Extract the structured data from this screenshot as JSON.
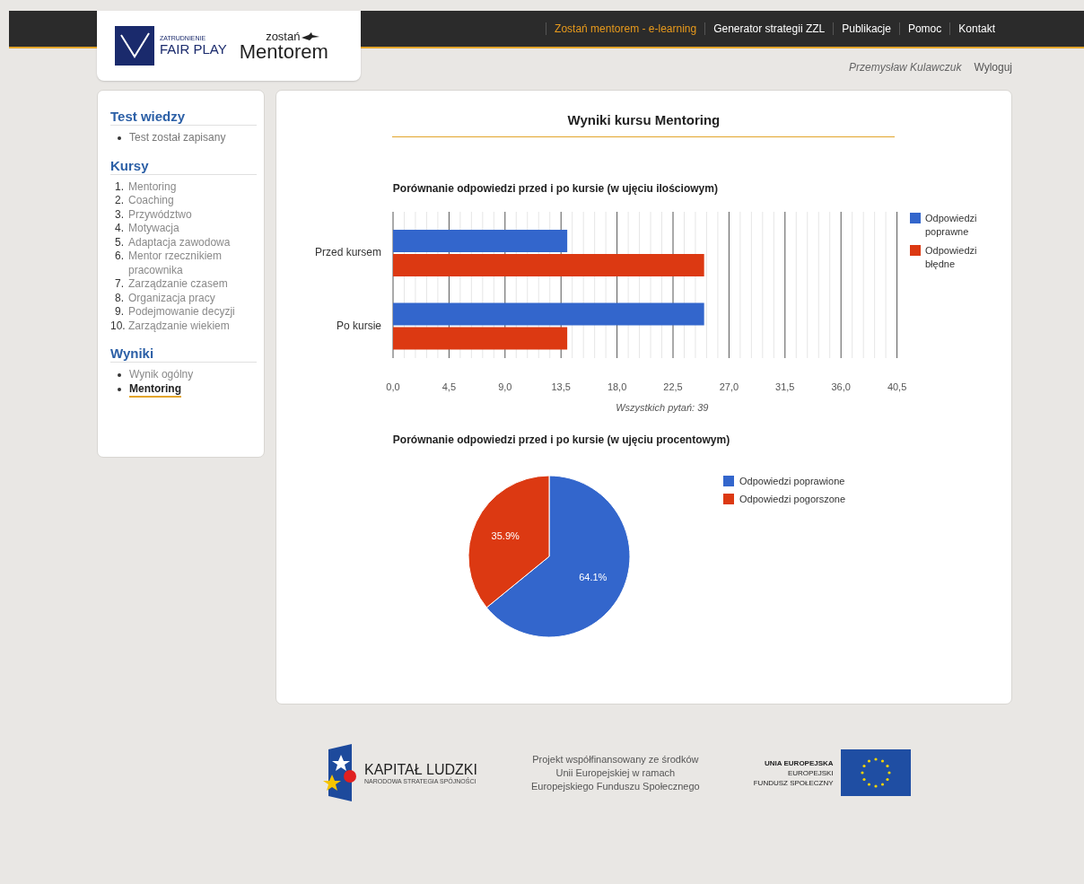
{
  "header": {
    "logo": {
      "small": "ZATRUDNIENIE",
      "name": "FAIR PLAY",
      "prefix": "zostań",
      "title": "Mentorem"
    },
    "nav": [
      {
        "label": "Zostań mentorem - e-learning",
        "selected": true
      },
      {
        "label": "Generator strategii ZZL",
        "selected": false
      },
      {
        "label": "Publikacje",
        "selected": false
      },
      {
        "label": "Pomoc",
        "selected": false
      },
      {
        "label": "Kontakt",
        "selected": false
      }
    ],
    "user": "Przemysław Kulawczuk",
    "logout": "Wyloguj"
  },
  "sidebar": [
    {
      "title": "Test wiedzy",
      "kind": "bullets",
      "items": [
        {
          "label": "Test został zapisany",
          "kind": "text",
          "selected": false
        }
      ]
    },
    {
      "title": "Kursy",
      "kind": "numbered",
      "items": [
        {
          "number": "1.",
          "label": "Mentoring",
          "kind": "link",
          "selected": false
        },
        {
          "number": "2.",
          "label": "Coaching",
          "kind": "link",
          "selected": false
        },
        {
          "number": "3.",
          "label": "Przywództwo",
          "kind": "link",
          "selected": false
        },
        {
          "number": "4.",
          "label": "Motywacja",
          "kind": "link",
          "selected": false
        },
        {
          "number": "5.",
          "label": "Adaptacja zawodowa",
          "kind": "link",
          "selected": false
        },
        {
          "number": "6.",
          "label": "Mentor rzecznikiem pracownika",
          "kind": "link",
          "selected": false
        },
        {
          "number": "7.",
          "label": "Zarządzanie czasem",
          "kind": "link",
          "selected": false
        },
        {
          "number": "8.",
          "label": "Organizacja pracy",
          "kind": "link",
          "selected": false
        },
        {
          "number": "9.",
          "label": "Podejmowanie decyzji",
          "kind": "link",
          "selected": false
        },
        {
          "number": "10.",
          "label": "Zarządzanie wiekiem",
          "kind": "link",
          "selected": false
        }
      ]
    },
    {
      "title": "Wyniki",
      "kind": "bullets",
      "items": [
        {
          "label": "Wynik ogólny",
          "kind": "link",
          "selected": false
        },
        {
          "label": "Mentoring",
          "kind": "link",
          "selected": true
        }
      ]
    }
  ],
  "main": {
    "title": "Wyniki kursu Mentoring",
    "bar_chart": {
      "chart_data": {
        "type": "bar",
        "orientation": "horizontal",
        "title": "Porównanie odpowiedzi przed i po kursie (w ujęciu ilościowym)",
        "xlabel": "Wszystkich pytań: 39",
        "categories": [
          "Przed kursem",
          "Po kursie"
        ],
        "series": [
          {
            "name": "Odpowiedzi poprawne",
            "color": "#3366cc",
            "values": [
              14,
              25
            ]
          },
          {
            "name": "Odpowiedzi błędne",
            "color": "#dc3912",
            "values": [
              25,
              14
            ]
          }
        ],
        "xlim": [
          0,
          40.5
        ],
        "grid": true,
        "legend": true,
        "xticks": [
          {
            "value": 0,
            "label": "0,0"
          },
          {
            "value": 4.5,
            "label": "4,5"
          },
          {
            "value": 9,
            "label": "9,0"
          },
          {
            "value": 13.5,
            "label": "13,5"
          },
          {
            "value": 18,
            "label": "18,0"
          },
          {
            "value": 22.5,
            "label": "22,5"
          },
          {
            "value": 27,
            "label": "27,0"
          },
          {
            "value": 31.5,
            "label": "31,5"
          },
          {
            "value": 36,
            "label": "36,0"
          },
          {
            "value": 40.5,
            "label": "40,5"
          }
        ]
      }
    },
    "pie_chart": {
      "chart_data": {
        "type": "pie",
        "title": "Porównanie odpowiedzi przed i po kursie (w ujęciu procentowym)",
        "categories": [
          "Odpowiedzi poprawione",
          "Odpowiedzi pogorszone"
        ],
        "values": [
          64.1,
          35.9
        ],
        "colors": [
          "#3366cc",
          "#dc3912"
        ],
        "legend": true,
        "value_labels": [
          "64.1%",
          "35.9%"
        ]
      }
    }
  },
  "footer": {
    "kl_title": "KAPITAŁ LUDZKI",
    "kl_subtitle": "NARODOWA STRATEGIA SPÓJNOŚCI",
    "note": [
      "Projekt współfinansowany ze środków",
      "Unii Europejskiej w ramach",
      "Europejskiego Funduszu Społecznego"
    ],
    "eu": [
      "UNIA EUROPEJSKA",
      "EUROPEJSKI",
      "FUNDUSZ SPOŁECZNY"
    ]
  }
}
